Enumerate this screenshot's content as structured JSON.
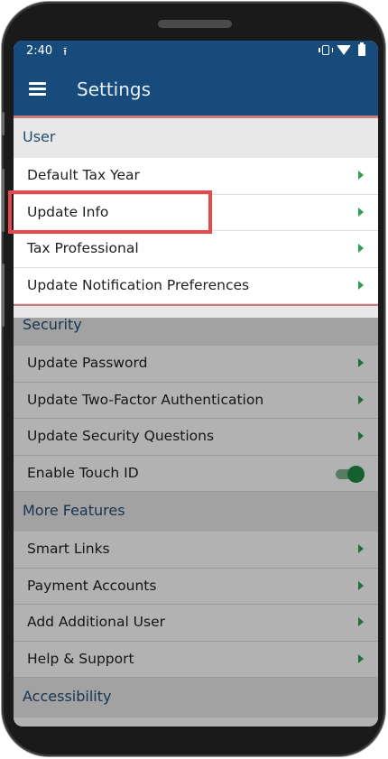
{
  "status_bar": {
    "time": "2:40",
    "upload_icon": "upload-icon"
  },
  "app_bar": {
    "title": "Settings",
    "menu_icon": "hamburger-menu-icon"
  },
  "sections": [
    {
      "title": "User",
      "items": [
        "Default Tax Year",
        "Update Info",
        "Tax Professional",
        "Update Notification Preferences"
      ]
    },
    {
      "title": "Security",
      "items": [
        "Update Password",
        "Update Two-Factor Authentication",
        "Update Security Questions",
        "Enable Touch ID"
      ]
    },
    {
      "title": "More Features",
      "items": [
        "Smart Links",
        "Payment Accounts",
        "Add Additional User",
        "Help & Support"
      ]
    },
    {
      "title": "Accessibility",
      "items": []
    }
  ],
  "touch_id_enabled": true,
  "highlighted_item": "Update Info",
  "colors": {
    "app_bar": "#174b7c",
    "section_text": "#244c74",
    "chevron": "#2f9e55",
    "toggle_on": "#1e8a46",
    "highlight": "#e8474e"
  }
}
